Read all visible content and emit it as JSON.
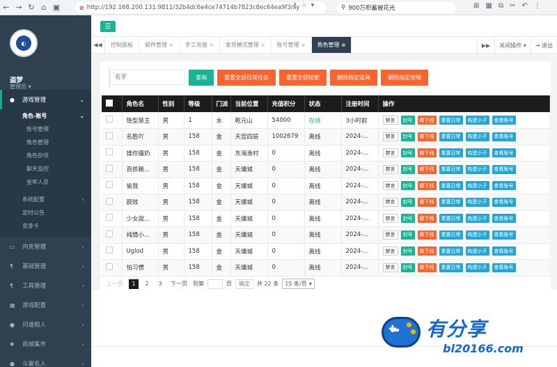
{
  "browser": {
    "url": "http://192.168.200.131:9811/32b4dc6e4ce74714b7823c8ec64ea9f3/sy",
    "search_text": "900万积蓄被花光"
  },
  "sidebar": {
    "user_name": "盗梦",
    "user_role": "管理员",
    "menu": [
      {
        "label": "游戏管理",
        "icon": "gamepad-icon",
        "active": true
      },
      {
        "label": "内充管理",
        "icon": "monitor-icon"
      },
      {
        "label": "基础管理",
        "icon": "cutlery-icon"
      },
      {
        "label": "工具管理",
        "icon": "cutlery-icon"
      },
      {
        "label": "游戏配置",
        "icon": "grid-icon"
      },
      {
        "label": "问道假人",
        "icon": "user-icon"
      },
      {
        "label": "商城集市",
        "icon": "gear-icon"
      },
      {
        "label": "斗案名人",
        "icon": "user-icon"
      }
    ],
    "submenu_group": "角色-账号",
    "submenu_items": [
      "账号管理",
      "角色管理",
      "角色杂项",
      "聊天监控",
      "坐牢人员"
    ],
    "submenu_after": [
      "系统配置",
      "定时公告",
      "变身卡"
    ]
  },
  "tabs": {
    "items": [
      "控制面板",
      "邮件管理",
      "手工充值",
      "发货模式管理",
      "账号管理",
      "角色管理"
    ],
    "close_ops": "关闭操作",
    "logout": "退出"
  },
  "filter": {
    "name_placeholder": "名字",
    "query": "查询",
    "reset_daily": "重置全部日常任务",
    "reset_skills": "重置全部技能",
    "delete_items": "删除指定道具",
    "delete_pets": "删除指定宠物"
  },
  "table": {
    "headers": [
      "角色名",
      "性别",
      "等级",
      "门派",
      "当前位置",
      "充值积分",
      "状态",
      "注册时间",
      "操作"
    ],
    "ops": [
      "禁言",
      "封号",
      "踢下线",
      "重置日常",
      "构建小子",
      "查看账号"
    ],
    "rows": [
      [
        "隐型慧主",
        "男",
        "1",
        "水",
        "乾元山",
        "54000",
        "在线",
        "3小时前"
      ],
      [
        "名胜吖",
        "男",
        "158",
        "金",
        "天宫四层",
        "1002679",
        "离线",
        "2024-..."
      ],
      [
        "揉你骚奶",
        "男",
        "158",
        "金",
        "东海渔村",
        "0",
        "离线",
        "2024-..."
      ],
      [
        "百依赖...",
        "男",
        "158",
        "金",
        "天墉城",
        "0",
        "离线",
        "2024-..."
      ],
      [
        "偷我",
        "男",
        "158",
        "金",
        "天墉城",
        "0",
        "离线",
        "2024-..."
      ],
      [
        "颜效",
        "男",
        "158",
        "金",
        "天墉城",
        "0",
        "离线",
        "2024-..."
      ],
      [
        "少女寂...",
        "男",
        "158",
        "金",
        "天墉城",
        "0",
        "离线",
        "2024-..."
      ],
      [
        "纯情小...",
        "男",
        "158",
        "金",
        "天墉城",
        "0",
        "离线",
        "2024-..."
      ],
      [
        "Uglod",
        "男",
        "158",
        "金",
        "天墉城",
        "0",
        "离线",
        "2024-..."
      ],
      [
        "怕习惯",
        "男",
        "158",
        "金",
        "天墉城",
        "0",
        "离线",
        "2024-..."
      ]
    ]
  },
  "pager": {
    "prev": "上一页",
    "pages": [
      "1",
      "2",
      "3"
    ],
    "next": "下一页",
    "goto": "到第",
    "page_unit": "页",
    "confirm": "确定",
    "total": "共 22 条",
    "page_size": "15 条/页"
  },
  "watermark": {
    "title": "有分享",
    "url": "bl20166.com"
  },
  "colors": {
    "sidebar_bg": "#2f4050",
    "accent_teal": "#1ab394",
    "accent_orange": "#f8632e",
    "accent_blue": "#23a6d5",
    "table_header": "#1c1c1c"
  }
}
